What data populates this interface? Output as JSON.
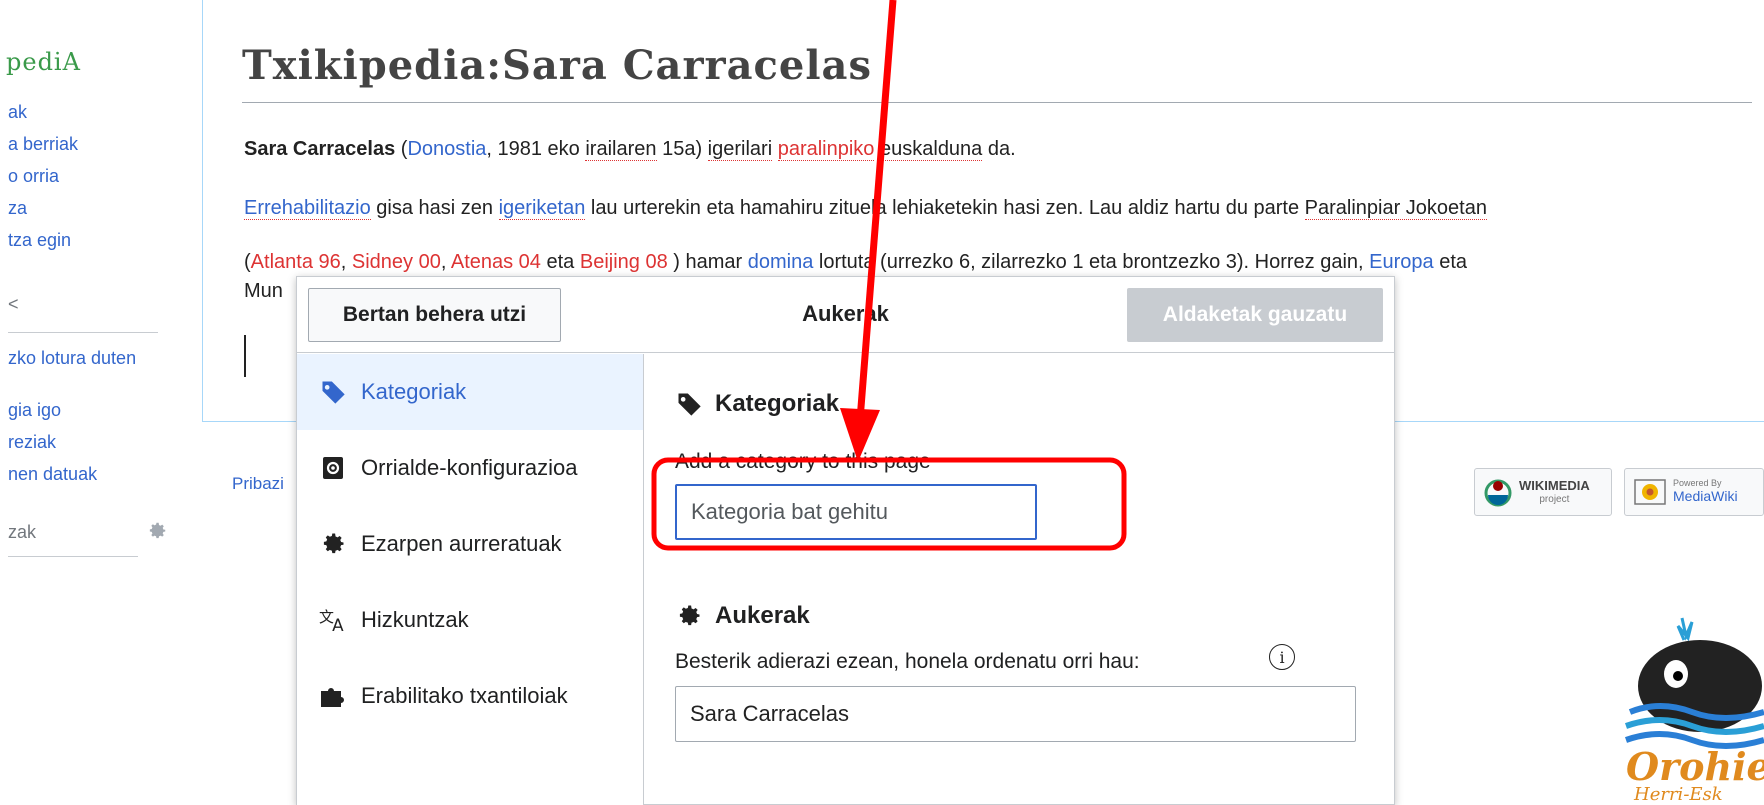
{
  "sidebar": {
    "logo": "pediA",
    "links": [
      "ak",
      "a berriak",
      "o orria",
      "za",
      "tza egin"
    ],
    "section_heading": "<",
    "tool_links": [
      "zko lotura duten",
      "gia igo",
      "reziak",
      "nen datuak"
    ],
    "lang_label": "zak"
  },
  "page": {
    "title": "Txikipedia:Sara Carracelas",
    "line1": {
      "name": "Sara Carracelas",
      "open": " (",
      "city": "Donostia",
      "date_a": ", 1981 eko ",
      "date_b": "irailaren",
      "date_c": " 15a) ",
      "w1": "igerilari",
      "w2": "paralinpiko",
      "w3": "euskalduna",
      "end": " da."
    },
    "line2": {
      "w1": "Errehabilitazio",
      "t1": " gisa hasi zen ",
      "w2": "igeriketan",
      "t2": " lau urterekin eta hamahiru zituela lehiaketekin hasi zen. Lau aldiz hartu du parte ",
      "w3": "Paralinpiar Jokoetan"
    },
    "line3": {
      "open": "(",
      "a": "Atlanta 96",
      "sep1": ", ",
      "b": "Sidney 00",
      "sep2": ", ",
      "c": "Atenas 04",
      "sep3": " eta ",
      "d": "Beijing 08",
      "t1": " ) hamar ",
      "e": "domina",
      "t2": " lortuta (urrezko 6, zilarrezko 1 eta brontzezko 3). Horrez gain, ",
      "f": "Europa",
      "t3": " eta"
    },
    "line4": "Mun"
  },
  "footer": {
    "privacy": "Pribazi",
    "wikimedia": "WIKIMEDIA",
    "wikimedia_sub": "project",
    "mediawiki_top": "Powered By",
    "mediawiki": "MediaWiki"
  },
  "whale_logo_text": [
    "Orohie",
    "Herri-Esk"
  ],
  "dialog": {
    "cancel_label": "Bertan behera utzi",
    "title": "Aukerak",
    "apply_label": "Aldaketak gauzatu",
    "nav": [
      {
        "label": "Kategoriak",
        "icon": "tag-icon",
        "active": true
      },
      {
        "label": "Orrialde-konfigurazioa",
        "icon": "settings-box-icon",
        "active": false
      },
      {
        "label": "Ezarpen aurreratuak",
        "icon": "gear-icon",
        "active": false
      },
      {
        "label": "Hizkuntzak",
        "icon": "language-icon",
        "active": false
      },
      {
        "label": "Erabilitako txantiloiak",
        "icon": "puzzle-icon",
        "active": false
      }
    ],
    "categories": {
      "heading": "Kategoriak",
      "description": "Add a category to this page",
      "input_placeholder": "Kategoria bat gehitu",
      "input_value": ""
    },
    "options": {
      "heading": "Aukerak",
      "sort_description": "Besterik adierazi ezean, honela ordenatu orri hau:",
      "sort_value": "Sara Carracelas"
    }
  },
  "colors": {
    "link": "#3366cc",
    "redlink": "#dd3333",
    "annotation": "#ff0000",
    "active_nav_bg": "#eaf3ff",
    "disabled_button": "#c8ccd1"
  }
}
